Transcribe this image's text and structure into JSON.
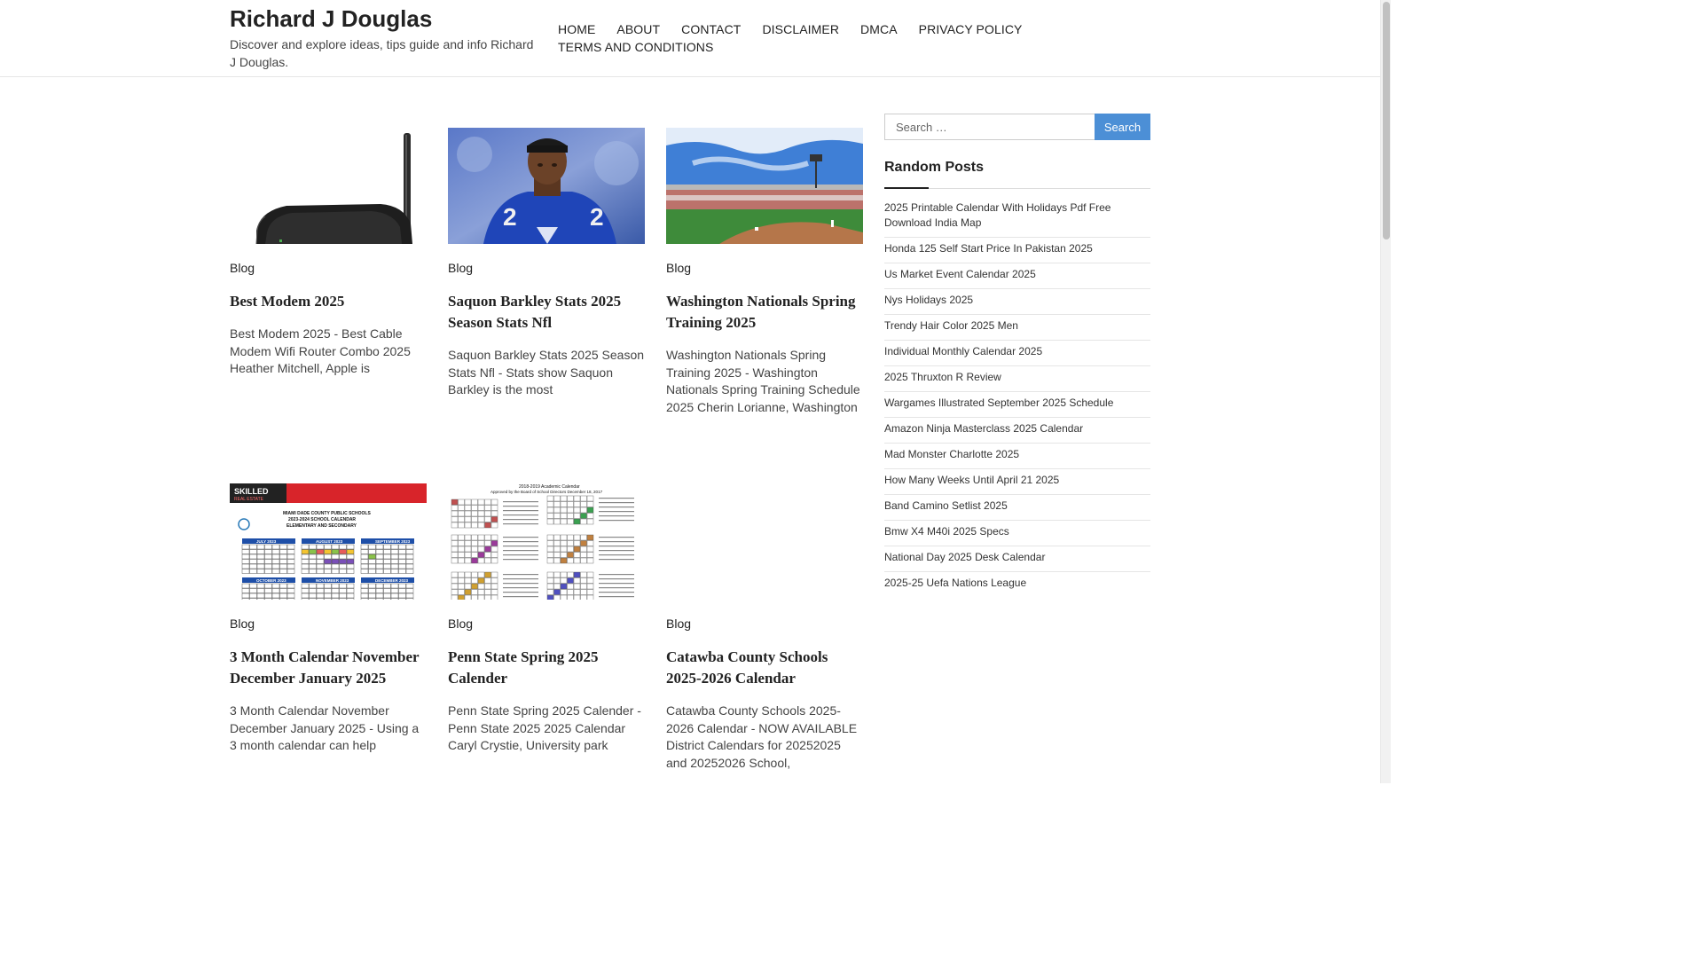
{
  "header": {
    "site_title": "Richard J Douglas",
    "site_description": "Discover and explore ideas, tips guide and info Richard J Douglas.",
    "nav": [
      "HOME",
      "ABOUT",
      "CONTACT",
      "DISCLAIMER",
      "DMCA",
      "PRIVACY POLICY",
      "TERMS AND CONDITIONS"
    ]
  },
  "posts": [
    {
      "category": "Blog",
      "title": "Best Modem 2025",
      "excerpt": "Best Modem 2025 - Best Cable Modem Wifi Router Combo 2025 Heather Mitchell, Apple is",
      "thumb_icon": "modem-router-photo"
    },
    {
      "category": "Blog",
      "title": "Saquon Barkley Stats 2025 Season Stats Nfl",
      "excerpt": "Saquon Barkley Stats 2025 Season Stats Nfl - Stats show Saquon Barkley is the most",
      "thumb_icon": "football-player-photo"
    },
    {
      "category": "Blog",
      "title": "Washington Nationals Spring Training 2025",
      "excerpt": "Washington Nationals Spring Training 2025 - Washington Nationals Spring Training Schedule 2025 Cherin Lorianne, Washington",
      "thumb_icon": "baseball-stadium-photo"
    },
    {
      "category": "Blog",
      "title": "3 Month Calendar November December January 2025",
      "excerpt": "3 Month Calendar November December January 2025 - Using a 3 month calendar can help",
      "thumb_icon": "school-calendar-image",
      "thumb_text": {
        "logo": "SKILLED",
        "logo_sub": "REAL ESTATE",
        "headline": "MIAMI DADE COUNTY PUBLIC SCHOOLS",
        "headline2": "2023-2024 SCHOOL CALENDAR",
        "headline3": "ELEMENTARY AND SECONDARY",
        "months": [
          "JULY 2023",
          "AUGUST 2023",
          "SEPTEMBER 2023",
          "OCTOBER 2023",
          "NOVEMBER 2023",
          "DECEMBER 2023"
        ]
      }
    },
    {
      "category": "Blog",
      "title": "Penn State Spring 2025 Calender",
      "excerpt": "Penn State Spring 2025 Calender - Penn State 2025 2025 Calendar Caryl Crystie, University park",
      "thumb_icon": "academic-calendar-image",
      "thumb_text": {
        "headline": "2018-2019 Academic Calendar",
        "sub": "Approved by the Board of School Directors December 18, 2017"
      }
    },
    {
      "category": "Blog",
      "title": "Catawba County Schools 2025-2026 Calendar",
      "excerpt": "Catawba County Schools 2025-2026 Calendar - NOW AVAILABLE District Calendars for 20252025 and 20252026 School,",
      "thumb_icon": "none"
    }
  ],
  "sidebar": {
    "search_placeholder": "Search …",
    "search_button": "Search",
    "widget_title": "Random Posts",
    "random_posts": [
      "2025 Printable Calendar With Holidays Pdf Free Download India Map",
      "Honda 125 Self Start Price In Pakistan 2025",
      "Us Market Event Calendar 2025",
      "Nys Holidays 2025",
      "Trendy Hair Color 2025 Men",
      "Individual Monthly Calendar 2025",
      "2025 Thruxton R Review",
      "Wargames Illustrated September 2025 Schedule",
      "Amazon Ninja Masterclass 2025 Calendar",
      "Mad Monster Charlotte 2025",
      "How Many Weeks Until April 21 2025",
      "Band Camino Setlist 2025",
      "Bmw X4 M40i 2025 Specs",
      "National Day 2025 Desk Calendar",
      "2025-25 Uefa Nations League"
    ]
  },
  "colors": {
    "accent": "#4c8fd6",
    "text": "#222222"
  }
}
